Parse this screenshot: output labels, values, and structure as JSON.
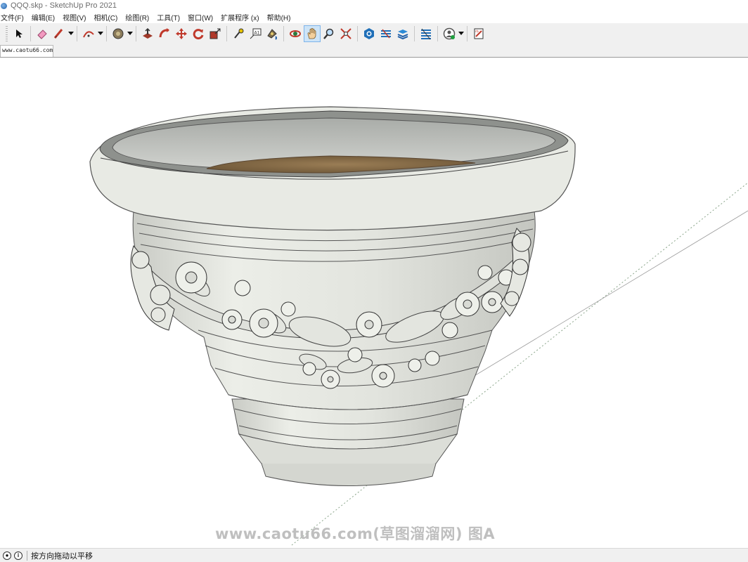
{
  "window": {
    "title": "QQQ.skp - SketchUp Pro 2021"
  },
  "menu": [
    {
      "label": "文件(F)"
    },
    {
      "label": "编辑(E)"
    },
    {
      "label": "视图(V)"
    },
    {
      "label": "相机(C)"
    },
    {
      "label": "绘图(R)"
    },
    {
      "label": "工具(T)"
    },
    {
      "label": "窗口(W)"
    },
    {
      "label": "扩展程序 (x)"
    },
    {
      "label": "帮助(H)"
    }
  ],
  "toolbar": {
    "icons": [
      "select-icon",
      "eraser-icon",
      "line-tool-icon",
      "arc-tool-icon",
      "paint-bucket-icon",
      "push-pull-icon",
      "follow-me-icon",
      "move-icon",
      "rotate-icon",
      "scale-icon",
      "tape-measure-icon",
      "text-tool-icon",
      "paint-icon",
      "orbit-icon",
      "pan-icon",
      "zoom-icon",
      "zoom-extents-icon",
      "warehouse-icon",
      "extension-warehouse-icon",
      "layout-icon",
      "extension-manager-icon",
      "account-icon",
      "send-to-layout-icon"
    ],
    "active": "pan-icon"
  },
  "tabs": [
    {
      "label": "www.caotu66.com"
    }
  ],
  "viewport": {
    "model": "ornamental-flower-pot",
    "watermark": "www.caotu66.com(草图溜溜网) 图A"
  },
  "status": {
    "text": "按方向拖动以平移"
  },
  "colors": {
    "toolbar_bg": "#f0f0f0",
    "active_btn": "#cde4f7",
    "pot_body": "#e6e8e2",
    "soil": "#8b6f4a"
  }
}
